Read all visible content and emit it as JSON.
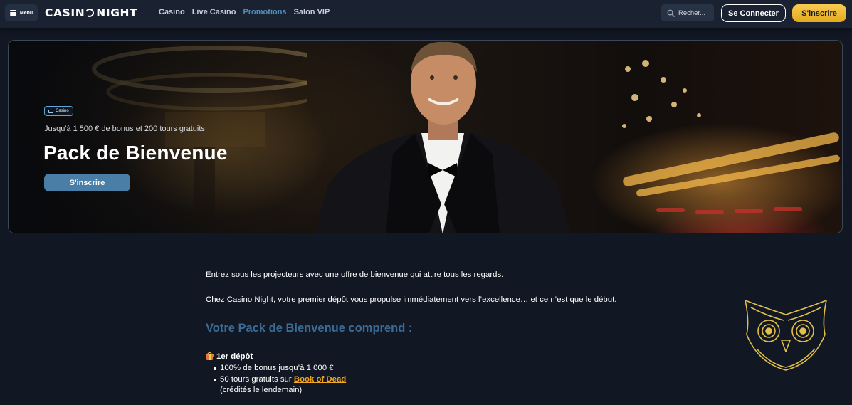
{
  "header": {
    "menu_label": "Menu",
    "logo_left": "CASIN",
    "logo_right": "NIGHT",
    "nav": [
      {
        "label": "Casino"
      },
      {
        "label": "Live Casino"
      },
      {
        "label": "Promotions"
      },
      {
        "label": "Salon VIP"
      }
    ],
    "active_nav": "Promotions",
    "search_placeholder": "Recher...",
    "login_label": "Se Connecter",
    "signup_label": "S'inscrire"
  },
  "hero": {
    "badge": "Casino",
    "subtitle": "Jusqu'à 1 500 € de bonus et 200 tours gratuits",
    "title": "Pack de Bienvenue",
    "cta": "S'inscrire"
  },
  "content": {
    "intro_1": "Entrez sous les projecteurs avec une offre de bienvenue qui attire tous les regards.",
    "intro_2": "Chez Casino Night, votre premier dépôt vous propulse immédiatement vers l’excellence… et ce n’est que le début.",
    "section_title": "Votre Pack de Bienvenue comprend :",
    "deposit_title": "1er dépôt",
    "bullet_1": "100% de bonus jusqu’à 1 000 €",
    "bullet_2_prefix": "50 tours gratuits sur",
    "bullet_2_link": "Book of Dead",
    "bullet_2_note": "(crédités le lendemain)"
  },
  "colors": {
    "background": "#111723",
    "header": "#1a2231",
    "accent_blue": "#4a7ea6",
    "section_title": "#3c6c96",
    "gold": "#f0b428"
  },
  "icons": [
    "menu-icon",
    "search-icon",
    "casino-icon",
    "gift-icon",
    "owl-logo"
  ]
}
